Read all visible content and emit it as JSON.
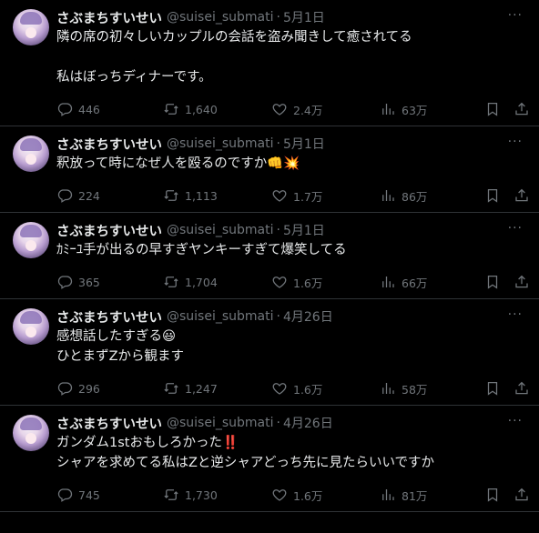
{
  "author": {
    "name": "さぶまちすいせい",
    "handle": "@suisei_submati",
    "separator": "·"
  },
  "more_label": "···",
  "tweets": [
    {
      "date": "5月1日",
      "lines": [
        "隣の席の初々しいカップルの会話を盗み聞きして癒されてる",
        "",
        "私はぼっちディナーです。"
      ],
      "replies": "446",
      "retweets": "1,640",
      "likes": "2.4万",
      "views": "63万"
    },
    {
      "date": "5月1日",
      "lines": [
        "釈放って時になぜ人を殴るのですか👊💥"
      ],
      "replies": "224",
      "retweets": "1,113",
      "likes": "1.7万",
      "views": "86万"
    },
    {
      "date": "5月1日",
      "lines": [
        "ｶﾐｰﾕ手が出るの早すぎヤンキーすぎて爆笑してる"
      ],
      "replies": "365",
      "retweets": "1,704",
      "likes": "1.6万",
      "views": "66万"
    },
    {
      "date": "4月26日",
      "lines": [
        "感想話したすぎる😃",
        "ひとまずZから観ます"
      ],
      "replies": "296",
      "retweets": "1,247",
      "likes": "1.6万",
      "views": "58万"
    },
    {
      "date": "4月26日",
      "lines": [
        "ガンダム1stおもしろかった‼️",
        "シャアを求めてる私はZと逆シャアどっち先に見たらいいですか"
      ],
      "replies": "745",
      "retweets": "1,730",
      "likes": "1.6万",
      "views": "81万"
    }
  ],
  "icons": [
    "reply-icon",
    "retweet-icon",
    "like-icon",
    "views-icon",
    "bookmark-icon",
    "share-icon"
  ],
  "colors": {
    "background": "#000000",
    "text": "#e7e9ea",
    "muted": "#71767b",
    "divider": "#2f3336"
  }
}
